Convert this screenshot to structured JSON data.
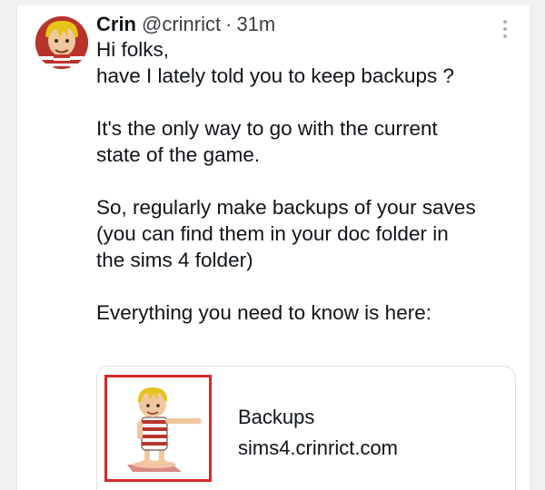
{
  "post": {
    "author_name": "Crin",
    "author_handle": "@crinrict",
    "separator": "·",
    "time": "31m",
    "more_icon": "vertical-ellipsis-icon",
    "avatar_icon": "cartoon-sim-avatar",
    "paragraphs": [
      [
        "Hi folks,",
        "have I lately told you to keep backups ?"
      ],
      [
        "It's the only way to go with the current",
        "state of the game."
      ],
      [
        "So, regularly make backups of your saves",
        "(you can find them in your doc folder in",
        "the sims 4 folder)"
      ],
      [
        "Everything you need to know is here:"
      ]
    ]
  },
  "link_card": {
    "title": "Backups",
    "domain": "sims4.crinrict.com",
    "thumbnail_icon": "cartoon-sim-in-striped-swimsuit",
    "thumbnail_border_color": "#d6282b"
  },
  "colors": {
    "text": "#0f1419",
    "secondary_text": "#3a3f44",
    "page_background": "#f1f1f1",
    "card_background": "#ffffff"
  }
}
